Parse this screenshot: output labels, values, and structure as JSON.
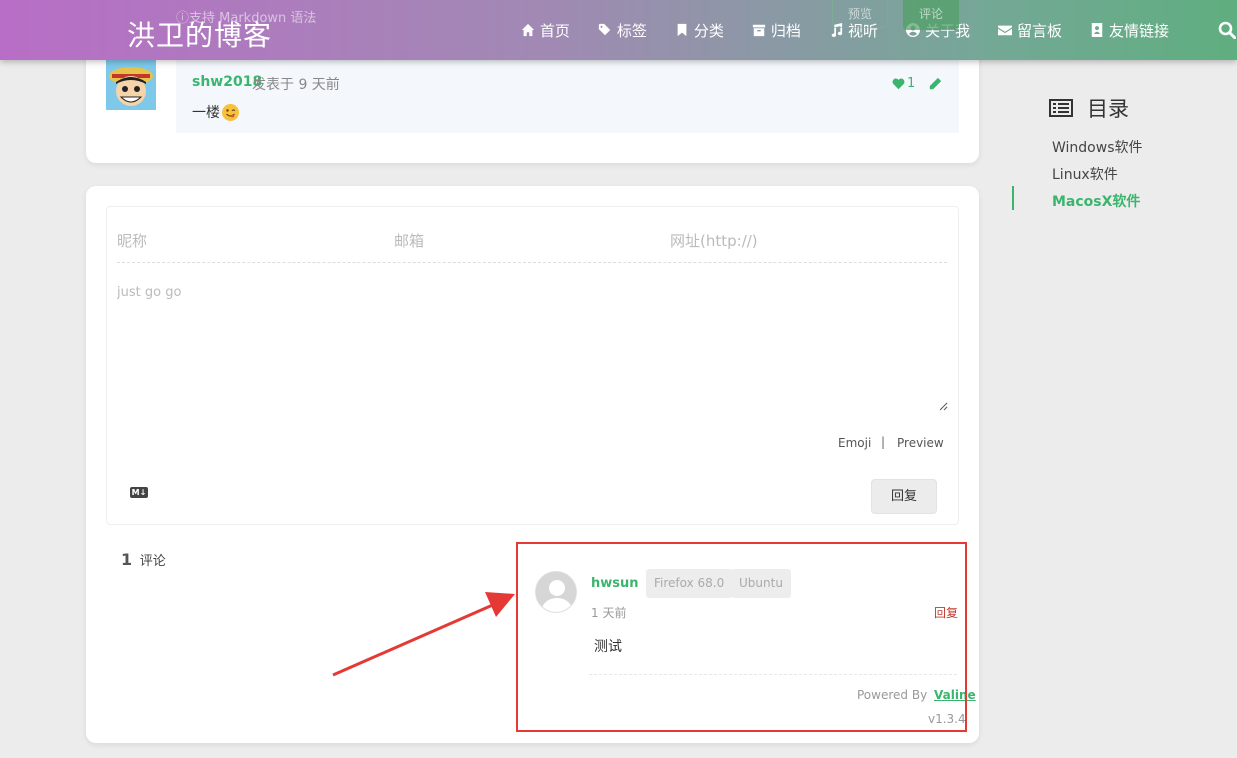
{
  "header": {
    "site_title": "洪卫的博客",
    "nav": [
      {
        "label": "首页",
        "icon": "home-icon"
      },
      {
        "label": "标签",
        "icon": "tags-icon"
      },
      {
        "label": "分类",
        "icon": "bookmark-icon"
      },
      {
        "label": "归档",
        "icon": "archive-icon"
      },
      {
        "label": "视听",
        "icon": "music-icon"
      },
      {
        "label": "关于我",
        "icon": "user-circle-icon"
      },
      {
        "label": "留言板",
        "icon": "envelope-icon"
      },
      {
        "label": "友情链接",
        "icon": "address-book-icon"
      }
    ],
    "search_icon": "search-icon",
    "peek_text": "ⓘ支持 Markdown 语法",
    "peek_preview": "预览",
    "peek_comment": "评论"
  },
  "reply": {
    "user": "shw2018",
    "meta": "发表于  9 天前",
    "text": "一楼",
    "likes": "1"
  },
  "toc": {
    "title": "目录",
    "items": [
      "Windows软件",
      "Linux软件",
      "MacosX软件"
    ],
    "active_index": 2
  },
  "form": {
    "nick_placeholder": "昵称",
    "email_placeholder": "邮箱",
    "url_placeholder": "网址(http://)",
    "content_placeholder": "just go go",
    "emoji_label": "Emoji",
    "separator": "|",
    "preview_label": "Preview",
    "md_label": "M↓",
    "submit_label": "回复"
  },
  "comments": {
    "count": "1",
    "count_label": "评论",
    "items": [
      {
        "user": "hwsun",
        "browser": "Firefox 68.0",
        "os": "Ubuntu",
        "time": "1 天前",
        "reply_label": "回复",
        "text": "测试"
      }
    ],
    "powered_by": "Powered By",
    "powered_link": "Valine",
    "version": "v1.3.4"
  },
  "colors": {
    "accent": "#3bb56e",
    "annotation": "#e53935",
    "reply_link": "#c0392b"
  }
}
